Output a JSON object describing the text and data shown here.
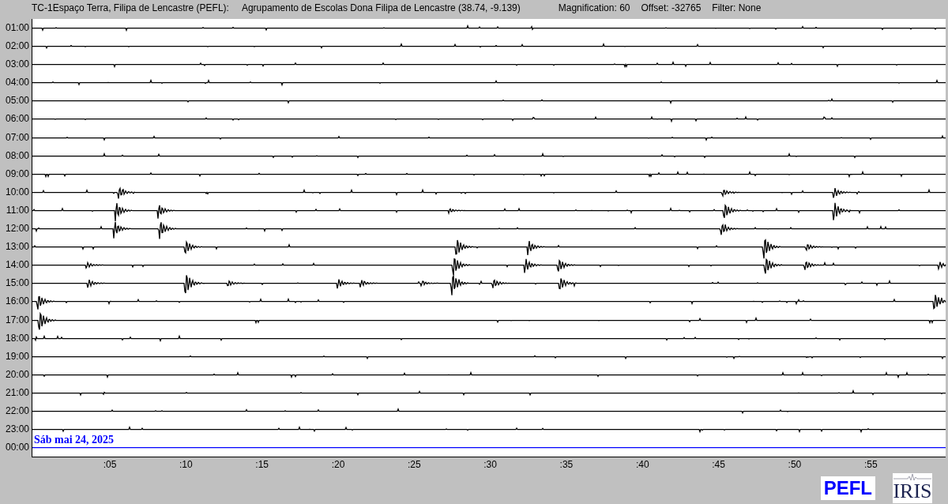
{
  "header": {
    "station": "TC-1Espaço Terra, Filipa de Lencastre (PEFL):",
    "site": "Agrupamento de Escolas Dona Filipa de Lencastre (38.74, -9.139)",
    "magnification": "Magnification: 60",
    "offset": "Offset: -32765",
    "filter": "Filter: None"
  },
  "rows": [
    "01:00",
    "02:00",
    "03:00",
    "04:00",
    "05:00",
    "06:00",
    "07:00",
    "08:00",
    "09:00",
    "10:00",
    "11:00",
    "12:00",
    "13:00",
    "14:00",
    "15:00",
    "16:00",
    "17:00",
    "18:00",
    "19:00",
    "20:00",
    "21:00",
    "22:00",
    "23:00",
    "00:00"
  ],
  "date_label": "Sáb mai 24, 2025",
  "x_ticks": [
    ":05",
    ":10",
    ":15",
    ":20",
    ":25",
    ":30",
    ":35",
    ":40",
    ":45",
    ":50",
    ":55"
  ],
  "logos": [
    {
      "kind": "text",
      "text": "PEFL"
    },
    {
      "kind": "seismic",
      "text": "IRIS"
    }
  ]
}
